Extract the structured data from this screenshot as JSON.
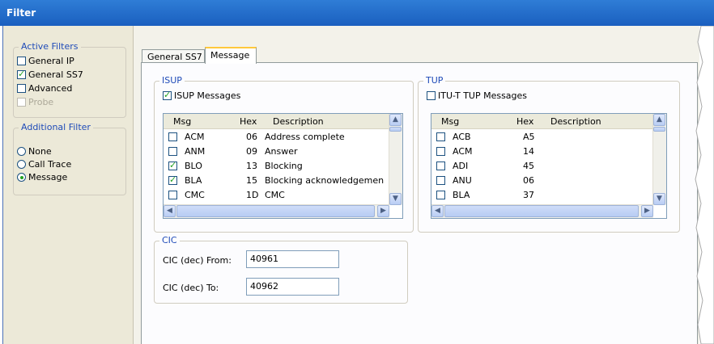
{
  "window": {
    "title": "Filter"
  },
  "active_filters": {
    "legend": "Active Filters",
    "items": [
      {
        "label": "General IP",
        "checked": false,
        "enabled": true
      },
      {
        "label": "General SS7",
        "checked": true,
        "enabled": true
      },
      {
        "label": "Advanced",
        "checked": false,
        "enabled": true
      },
      {
        "label": "Probe",
        "checked": false,
        "enabled": false
      }
    ]
  },
  "additional_filter": {
    "legend": "Additional Filter",
    "options": [
      {
        "label": "None",
        "selected": false
      },
      {
        "label": "Call Trace",
        "selected": false
      },
      {
        "label": "Message",
        "selected": true
      }
    ]
  },
  "tabs": [
    {
      "label": "General SS7",
      "active": false
    },
    {
      "label": "Message",
      "active": true
    }
  ],
  "isup": {
    "legend": "ISUP",
    "checkbox_label": "ISUP Messages",
    "checked": true,
    "columns": [
      "Msg",
      "Hex",
      "Description"
    ],
    "rows": [
      {
        "msg": "ACM",
        "hex": "06",
        "desc": "Address complete",
        "checked": false
      },
      {
        "msg": "ANM",
        "hex": "09",
        "desc": "Answer",
        "checked": false
      },
      {
        "msg": "BLO",
        "hex": "13",
        "desc": "Blocking",
        "checked": true
      },
      {
        "msg": "BLA",
        "hex": "15",
        "desc": "Blocking acknowledgemen",
        "checked": true
      },
      {
        "msg": "CMC",
        "hex": "1D",
        "desc": "CMC",
        "checked": false
      }
    ]
  },
  "tup": {
    "legend": "TUP",
    "checkbox_label": "ITU-T TUP Messages",
    "checked": false,
    "columns": [
      "Msg",
      "Hex",
      "Description"
    ],
    "rows": [
      {
        "msg": "ACB",
        "hex": "A5",
        "desc": "",
        "checked": false
      },
      {
        "msg": "ACM",
        "hex": "14",
        "desc": "",
        "checked": false
      },
      {
        "msg": "ADI",
        "hex": "45",
        "desc": "",
        "checked": false
      },
      {
        "msg": "ANU",
        "hex": "06",
        "desc": "",
        "checked": false
      },
      {
        "msg": "BLA",
        "hex": "37",
        "desc": "",
        "checked": false
      }
    ]
  },
  "cic": {
    "legend": "CIC",
    "from_label": "CIC (dec) From:",
    "from_value": "40961",
    "to_label": "CIC (dec) To:",
    "to_value": "40962"
  },
  "colors": {
    "title_bar": "#1a5fbf",
    "legend_text": "#1f4bb8",
    "check": "#21a121"
  }
}
